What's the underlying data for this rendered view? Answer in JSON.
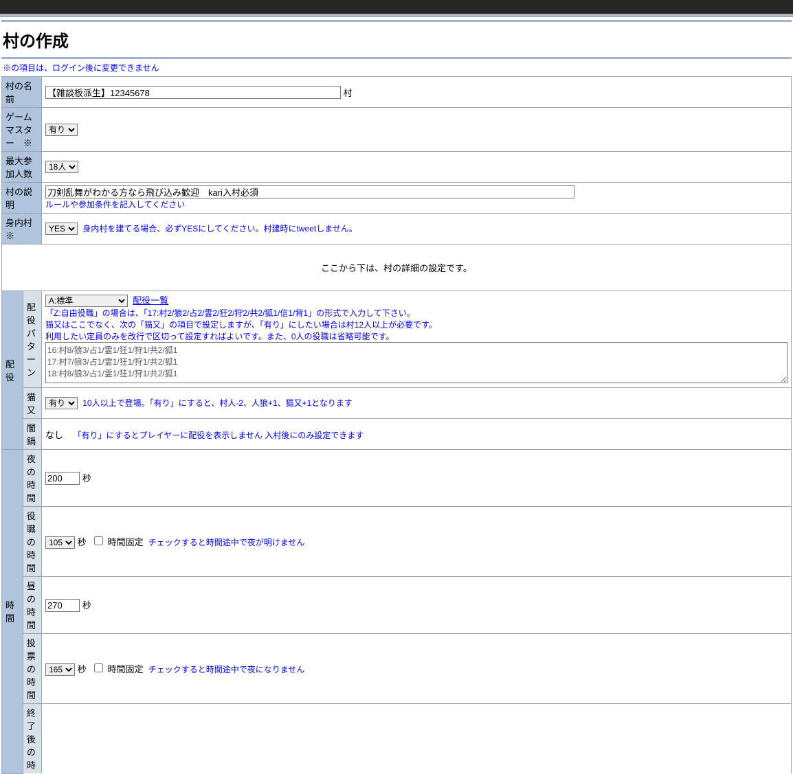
{
  "title": "村の作成",
  "top_notice": "※の項目は、ログイン後に変更できません",
  "labels": {
    "village_name": "村の名前",
    "gamemaster": "ゲームマスター　※",
    "max_players": "最大参加人数",
    "description": "村の説明",
    "private": "身内村　※",
    "roles": "配役",
    "role_pattern": "配役パターン",
    "nekomata": "猫又",
    "yaminabe": "闇鍋",
    "time": "時間",
    "night_time": "夜の時間",
    "role_time": "役職の時間",
    "day_time": "昼の時間",
    "vote_time": "投票の時間",
    "after_time": "終了後の時"
  },
  "values": {
    "village_name": "【雑談板派生】12345678",
    "village_suffix": "村",
    "gamemaster": "有り",
    "max_players": "18人",
    "description": "刀剣乱舞がわかる方なら飛び込み歓迎　kari入村必須",
    "private": "YES",
    "pattern_select": "A:標準",
    "pattern_textarea": "16:村8/狼3/占1/霊1/狂1/狩1/共2/狐1\n17:村7/狼3/占1/霊1/狂1/狩1/共2/狐1\n18:村8/狼3/占1/霊1/狂1/狩1/共2/狐1",
    "nekomata": "有り",
    "yaminabe": "なし",
    "night_time": "200",
    "role_time": "105",
    "day_time": "270",
    "vote_time": "165"
  },
  "helptext": {
    "desc_hint": "ルールや参加条件を記入してください",
    "private_hint": "身内村を建てる場合、必ずYESにしてください。村建時にtweetしません。",
    "section_header": "ここから下は、村の詳細の設定です。",
    "pattern_link": "配役一覧",
    "pattern_note1": "「Z:自由役職」の場合は、「17:村2/狼2/占2/霊2/狂2/狩2/共2/狐1/信1/背1」の形式で入力して下さい。",
    "pattern_note2": "猫又はここでなく、次の「猫又」の項目で設定しますが、「有り」にしたい場合は村12人以上が必要です。",
    "pattern_note3": "利用したい定員のみを改行で区切って設定すればよいです。また、0人の役職は省略可能です。",
    "nekomata_hint": "10人以上で登場。「有り」にすると、村人-2、人狼+1、猫又+1となります",
    "yaminabe_hint": "「有り」にするとプレイヤーに配役を表示しません 入村後にのみ設定できます",
    "sec": "秒",
    "time_fixed": "時間固定",
    "role_time_hint": "チェックすると時間途中で夜が明けません",
    "vote_time_hint": "チェックすると時間途中で夜になりません"
  }
}
